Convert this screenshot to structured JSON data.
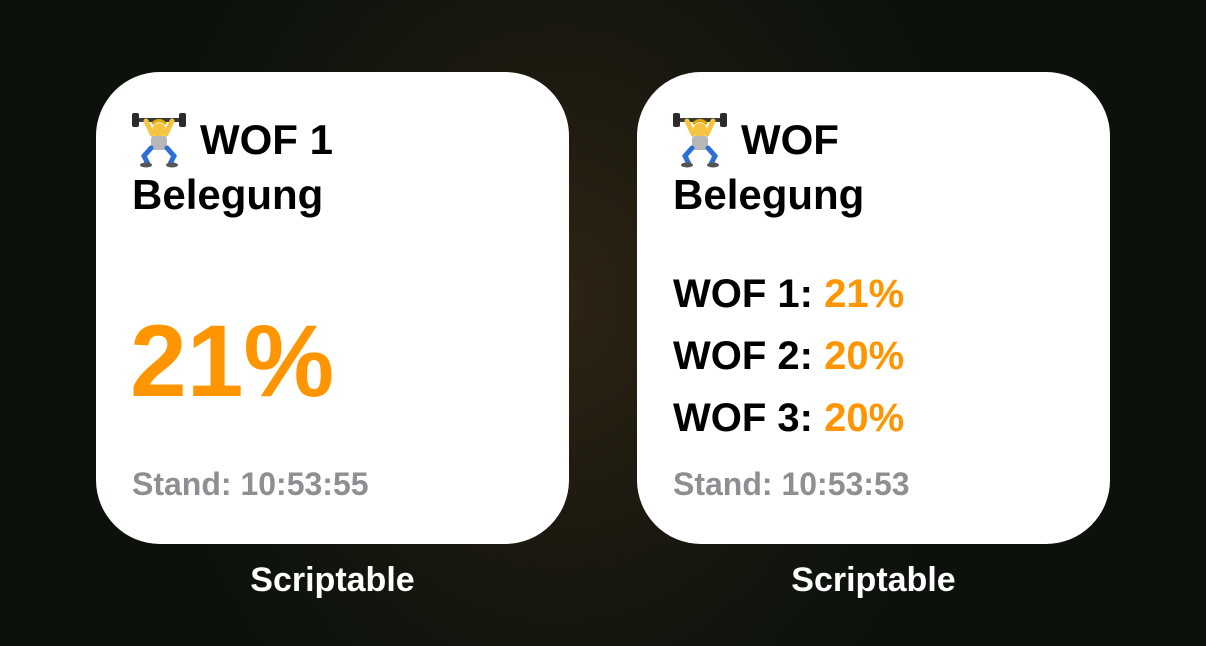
{
  "widgets": [
    {
      "title_line1": "WOF 1",
      "title_line2": "Belegung",
      "value": "21%",
      "stand": "Stand: 10:53:55",
      "app_label": "Scriptable"
    },
    {
      "title_line1": "WOF",
      "title_line2": "Belegung",
      "rows": [
        {
          "name": "WOF 1:",
          "value": "21%"
        },
        {
          "name": "WOF 2:",
          "value": "20%"
        },
        {
          "name": "WOF 3:",
          "value": "20%"
        }
      ],
      "stand": "Stand: 10:53:53",
      "app_label": "Scriptable"
    }
  ],
  "colors": {
    "accent": "#ff9500",
    "secondary_text": "#8e8e93",
    "widget_bg": "#ffffff"
  },
  "icons": {
    "title_icon": "weightlifter-emoji-icon"
  }
}
